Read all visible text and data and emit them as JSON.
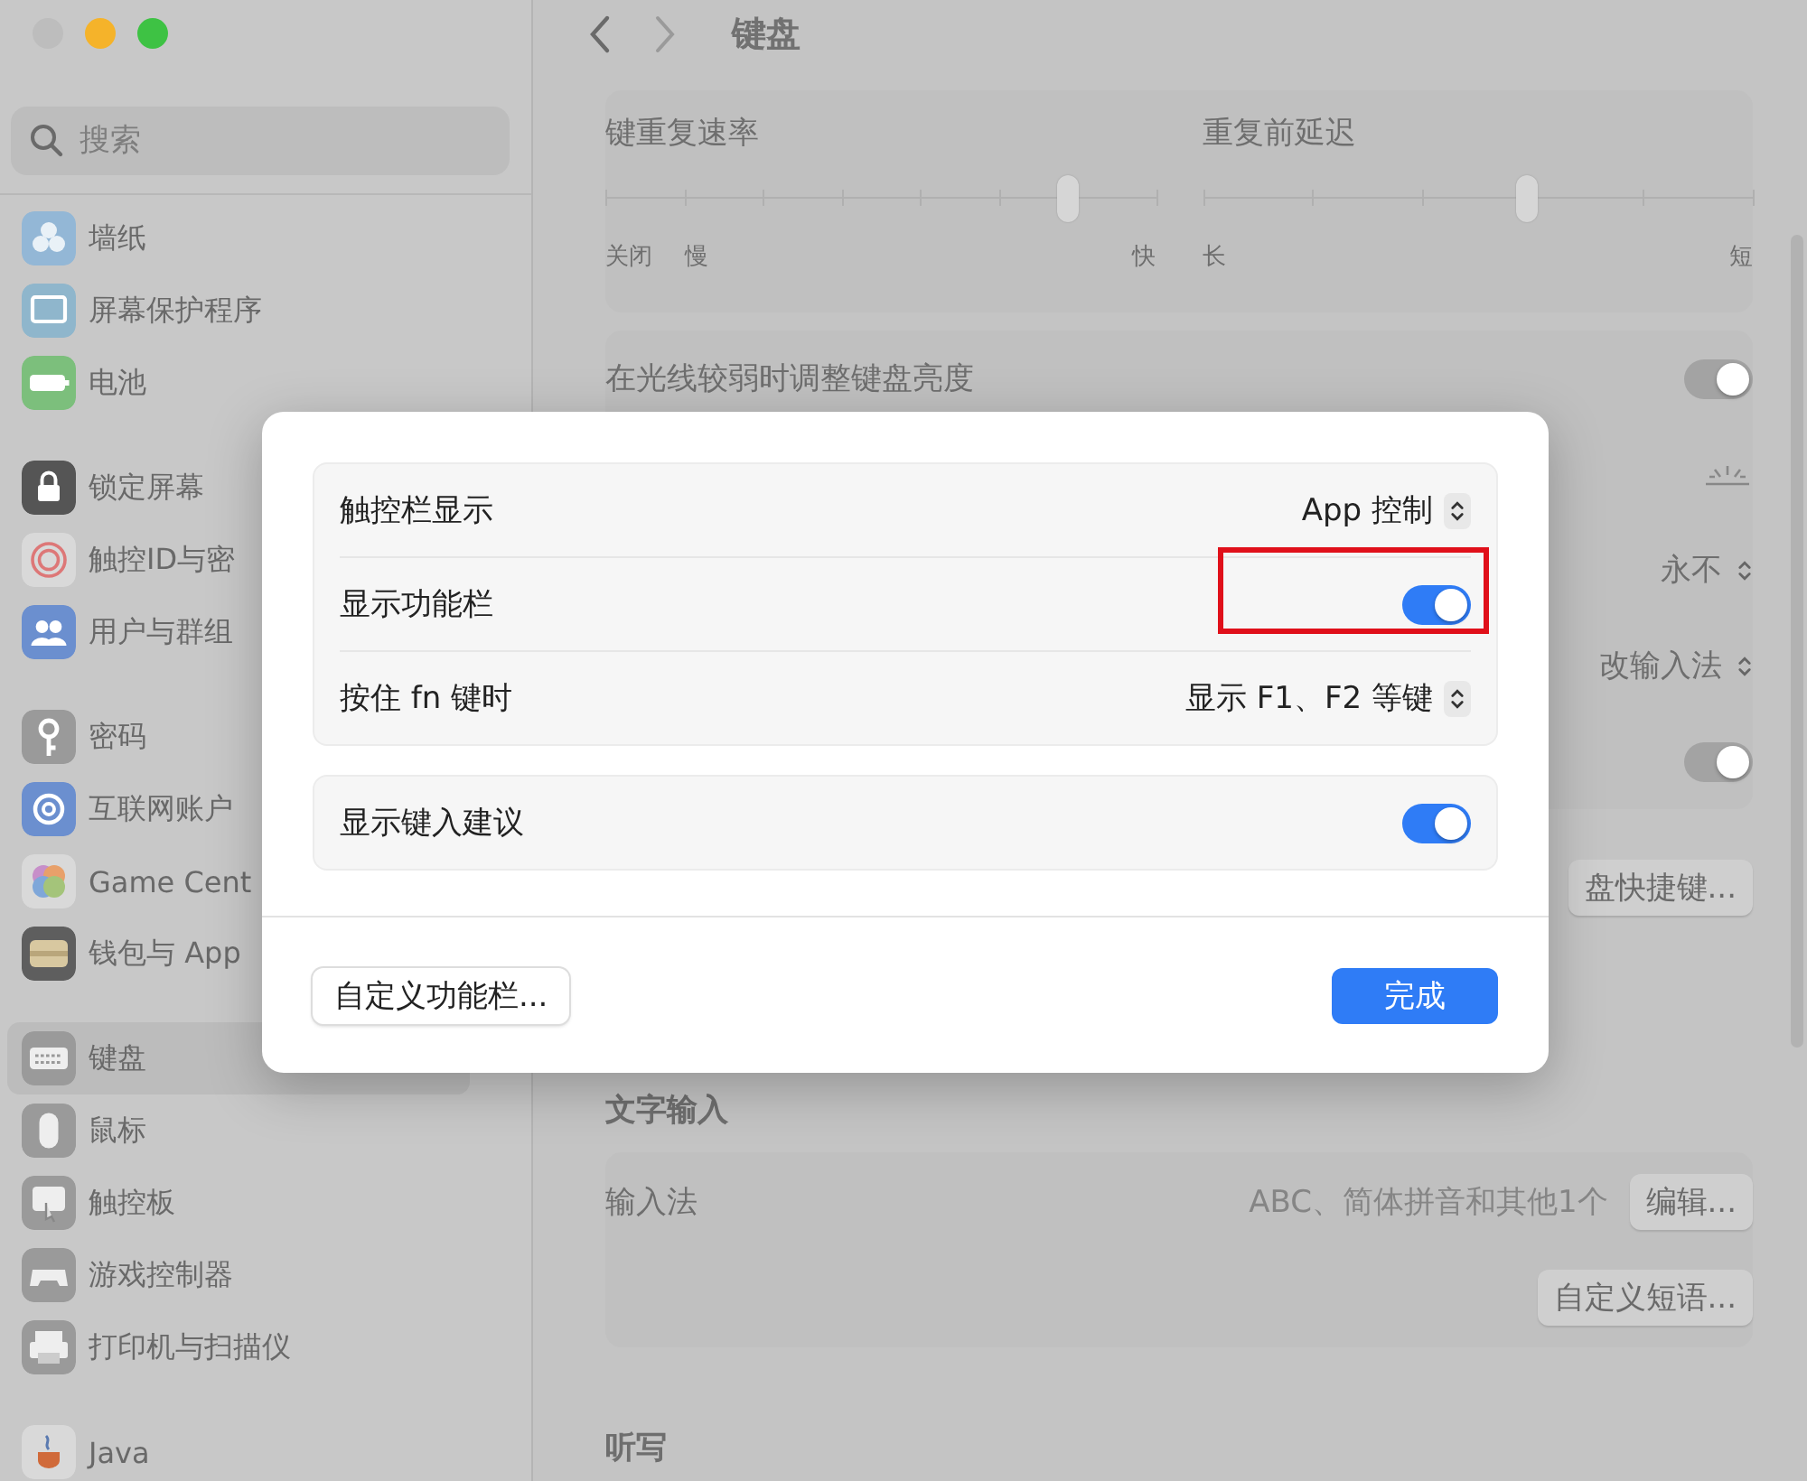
{
  "window": {
    "title": "键盘",
    "traffic_lights": [
      {
        "color": "#bdbdbd"
      },
      {
        "color": "#f5b32a"
      },
      {
        "color": "#3ec244"
      }
    ]
  },
  "sidebar": {
    "search": {
      "placeholder": "搜索"
    },
    "groups": [
      {
        "items": [
          {
            "label": "墙纸",
            "color": "#93b7d6",
            "selected": false
          },
          {
            "label": "屏幕保护程序",
            "color": "#8fb6cc",
            "selected": false
          },
          {
            "label": "电池",
            "color": "#7cbf7c",
            "selected": false
          }
        ]
      },
      {
        "items": [
          {
            "label": "锁定屏幕",
            "color": "#555555",
            "selected": false
          },
          {
            "label": "触控ID与密",
            "color": "#d9d9d9",
            "selected": false
          },
          {
            "label": "用户与群组",
            "color": "#6b8fcf",
            "selected": false
          }
        ]
      },
      {
        "items": [
          {
            "label": "密码",
            "color": "#9a9a9a",
            "selected": false
          },
          {
            "label": "互联网账户",
            "color": "#6b8fcf",
            "selected": false
          },
          {
            "label": "Game Cent",
            "color": "#d9d9d9",
            "selected": false
          },
          {
            "label": "钱包与 App",
            "color": "#5e5e5e",
            "selected": false
          }
        ]
      },
      {
        "items": [
          {
            "label": "键盘",
            "color": "#9a9a9a",
            "selected": true
          },
          {
            "label": "鼠标",
            "color": "#9a9a9a",
            "selected": false
          },
          {
            "label": "触控板",
            "color": "#9a9a9a",
            "selected": false
          },
          {
            "label": "游戏控制器",
            "color": "#9a9a9a",
            "selected": false
          },
          {
            "label": "打印机与扫描仪",
            "color": "#9a9a9a",
            "selected": false
          }
        ]
      },
      {
        "items": [
          {
            "label": "Java",
            "color": "#d9d9d9",
            "selected": false
          }
        ]
      }
    ]
  },
  "main": {
    "sliders": [
      {
        "title": "键重复速率",
        "level": 0.84,
        "labels": [
          "关闭",
          "慢",
          "快"
        ]
      },
      {
        "title": "重复前延迟",
        "level": 0.59,
        "labels": [
          "长",
          "短"
        ]
      }
    ],
    "rows": [
      {
        "kind": "toggle",
        "label": "在光线较弱时调整键盘亮度",
        "on": true
      },
      {
        "kind": "brightness"
      },
      {
        "kind": "popup",
        "value": "永不"
      },
      {
        "kind": "popup",
        "value": "改输入法"
      },
      {
        "kind": "toggle",
        "on": true
      }
    ],
    "shortcut_button": "盘快捷键...",
    "text_input": {
      "title": "文字输入",
      "label": "输入法",
      "value": "ABC、简体拼音和其他1个",
      "edit_button": "编辑...",
      "phrases_button": "自定义短语..."
    },
    "dictation": {
      "title": "听写"
    }
  },
  "dialog": {
    "groups": [
      {
        "rows": [
          {
            "kind": "popup",
            "label": "触控栏显示",
            "value": "App 控制",
            "highlighted": false
          },
          {
            "kind": "toggle",
            "label": "显示功能栏",
            "on": true,
            "highlighted": true
          },
          {
            "kind": "popup",
            "label": "按住 fn 键时",
            "value": "显示 F1、F2 等键",
            "highlighted": false
          }
        ]
      },
      {
        "rows": [
          {
            "kind": "toggle",
            "label": "显示键入建议",
            "on": true,
            "highlighted": false
          }
        ]
      }
    ],
    "customize_button": "自定义功能栏...",
    "done_button": "完成"
  }
}
